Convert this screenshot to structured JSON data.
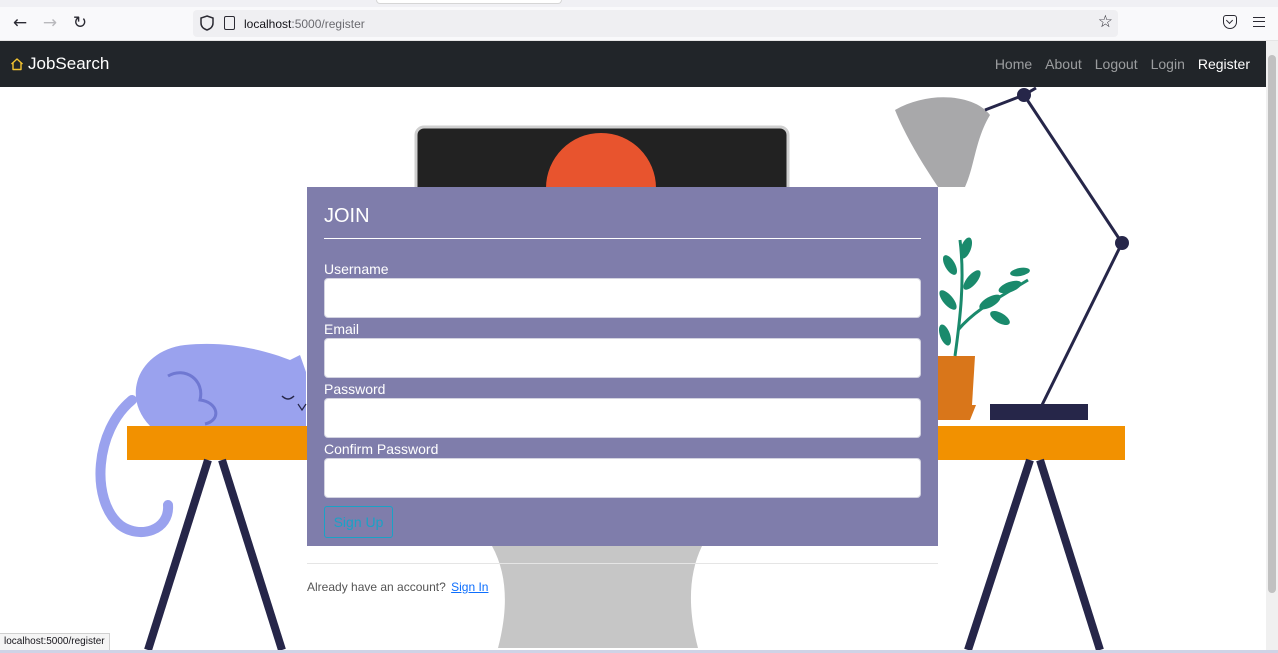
{
  "browser": {
    "url_host": "localhost",
    "url_path": ":5000/register",
    "status_url": "localhost:5000/register"
  },
  "navbar": {
    "brand": "JobSearch",
    "links": [
      {
        "label": "Home"
      },
      {
        "label": "About"
      },
      {
        "label": "Logout"
      },
      {
        "label": "Login"
      },
      {
        "label": "Register",
        "active": true
      }
    ]
  },
  "form": {
    "legend": "JOIN",
    "fields": [
      {
        "label": "Username",
        "value": ""
      },
      {
        "label": "Email",
        "value": ""
      },
      {
        "label": "Password",
        "value": ""
      },
      {
        "label": "Confirm Password",
        "value": ""
      }
    ],
    "submit_label": "Sign Up"
  },
  "footer": {
    "prompt": "Already have an account?",
    "link_label": "Sign In"
  },
  "colors": {
    "navbar_bg": "#212529",
    "card_bg": "#7f7dab",
    "button_accent": "#1aa2c6",
    "desk": "#f29100"
  },
  "icons": {
    "back": "back-arrow-icon",
    "forward": "forward-arrow-icon",
    "reload": "reload-icon",
    "bookmark": "star-icon",
    "brand": "house-icon"
  }
}
